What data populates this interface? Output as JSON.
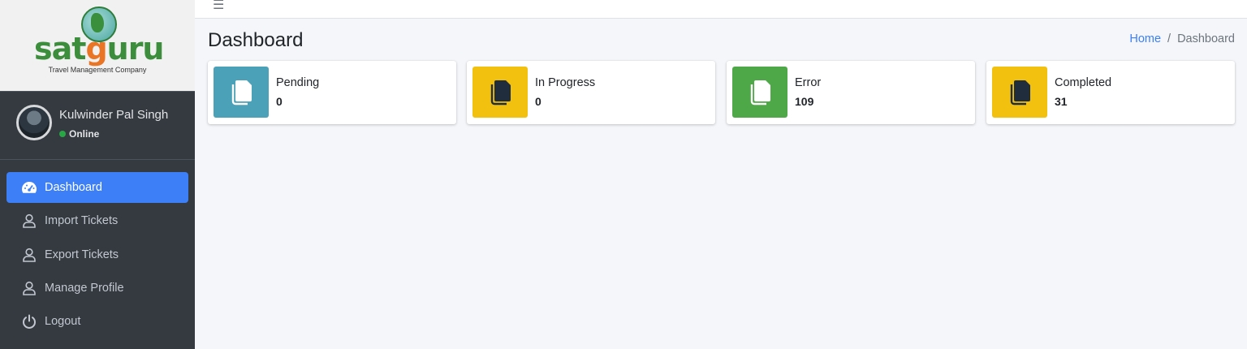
{
  "brand": {
    "name_prefix": "sat",
    "name_g": "g",
    "name_suffix": "uru",
    "tagline": "Travel Management Company",
    "colors": {
      "green": "#3c8d3c",
      "orange": "#e97525"
    }
  },
  "user": {
    "name": "Kulwinder Pal Singh",
    "status": "Online"
  },
  "nav": {
    "items": [
      {
        "label": "Dashboard",
        "icon": "tachometer-icon",
        "active": true
      },
      {
        "label": "Import Tickets",
        "icon": "user-icon",
        "active": false
      },
      {
        "label": "Export Tickets",
        "icon": "user-icon",
        "active": false
      },
      {
        "label": "Manage Profile",
        "icon": "user-icon",
        "active": false
      },
      {
        "label": "Logout",
        "icon": "power-icon",
        "active": false
      }
    ]
  },
  "header": {
    "menu_icon": "hamburger-icon",
    "title": "Dashboard"
  },
  "breadcrumb": {
    "home": "Home",
    "separator": "/",
    "current": "Dashboard"
  },
  "cards": [
    {
      "label": "Pending",
      "value": "0",
      "color": "#4ba1b7",
      "icon": "copy-icon"
    },
    {
      "label": "In Progress",
      "value": "0",
      "color": "#f2c00f",
      "icon": "copy-icon"
    },
    {
      "label": "Error",
      "value": "109",
      "color": "#4ea848",
      "icon": "copy-icon"
    },
    {
      "label": "Completed",
      "value": "31",
      "color": "#f2c00f",
      "icon": "copy-icon"
    }
  ]
}
